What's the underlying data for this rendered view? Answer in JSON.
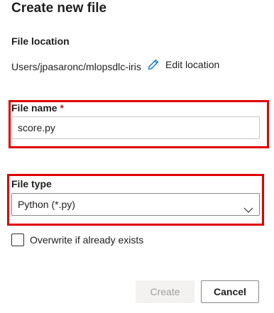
{
  "dialog": {
    "title": "Create new file"
  },
  "location": {
    "label": "File location",
    "path": "Users/jpasaronc/mlopsdlc-iris",
    "edit_label": "Edit location"
  },
  "file_name": {
    "label": "File name",
    "required_marker": "*",
    "value": "score.py"
  },
  "file_type": {
    "label": "File type",
    "selected": "Python (*.py)"
  },
  "overwrite": {
    "label": "Overwrite if already exists",
    "checked": false
  },
  "buttons": {
    "create_label": "Create",
    "cancel_label": "Cancel"
  },
  "colors": {
    "highlight": "#e00000",
    "required": "#a4262c",
    "edit_icon": "#0078d4"
  }
}
